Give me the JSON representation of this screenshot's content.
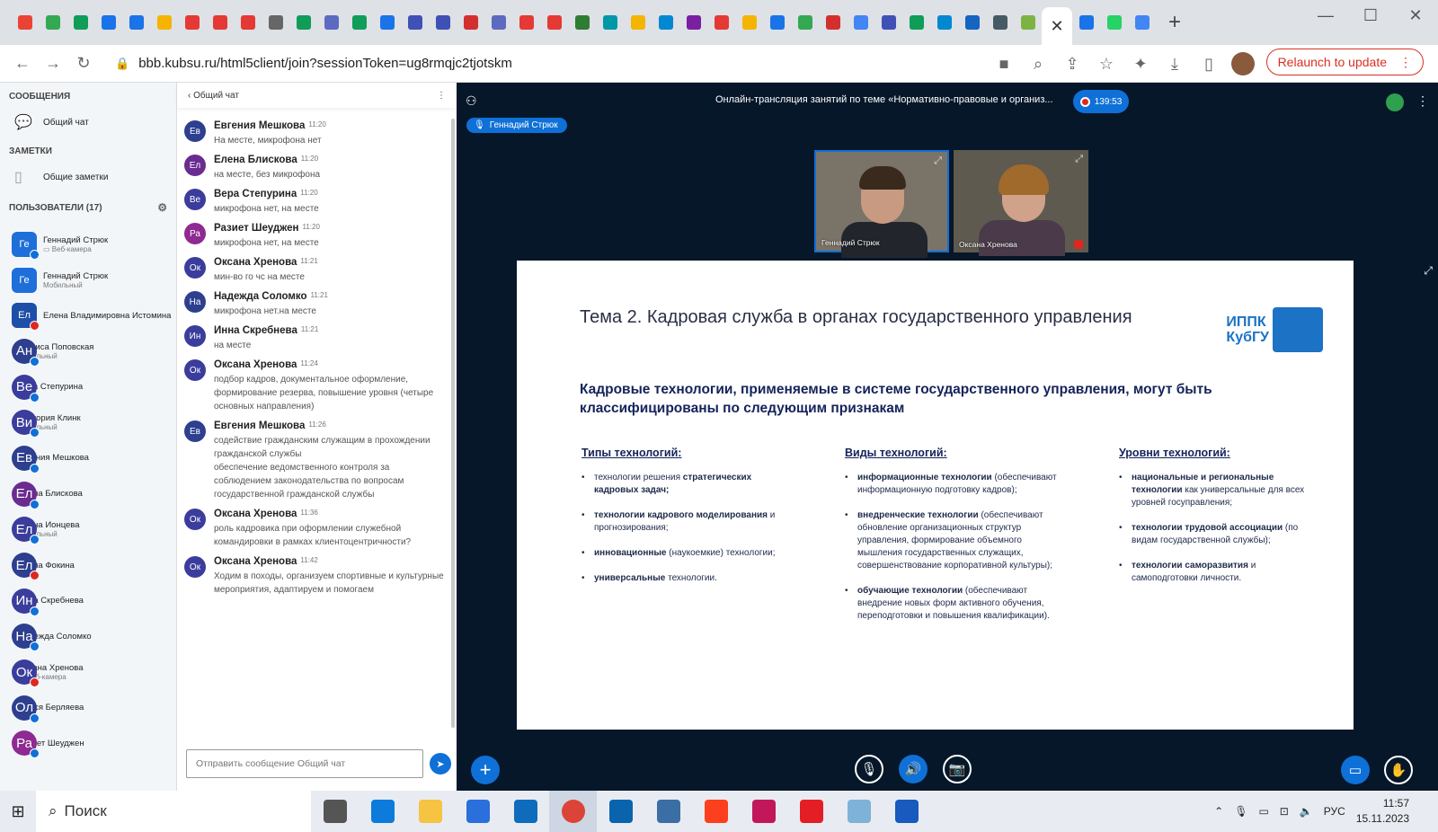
{
  "browser": {
    "tab_colors": [
      "#ea4335",
      "#34a853",
      "#0f9d58",
      "#1a73e8",
      "#1a73e8",
      "#f4b400",
      "#e53935",
      "#e53935",
      "#e53935",
      "#666666",
      "#0f9d58",
      "#5c6bc0",
      "#0f9d58",
      "#1a73e8",
      "#3f51b5",
      "#3f51b5",
      "#d32f2f",
      "#5c6bc0",
      "#e53935",
      "#e53935",
      "#2e7d32",
      "#0097a7",
      "#f4b400",
      "#0288d1",
      "#7b1fa2",
      "#e53935",
      "#f4b400",
      "#1a73e8",
      "#34a853",
      "#d32f2f",
      "#4285f4",
      "#3f51b5",
      "#0f9d58",
      "#0288d1",
      "#1565c0",
      "#455a64",
      "#7cb342",
      "#1a73e8",
      "#25d366",
      "#4285f4"
    ],
    "active_tab_close": "✕",
    "url": "bbb.kubsu.ru/html5client/join?sessionToken=ug8rmqjc2tjotskm",
    "relaunch_label": "Relaunch to update"
  },
  "sidebar": {
    "messages_title": "СООБЩЕНИЯ",
    "public_chat": "Общий чат",
    "notes_title": "ЗАМЕТКИ",
    "shared_notes": "Общие заметки",
    "users_title": "ПОЛЬЗОВАТЕЛИ (17)",
    "users": [
      {
        "initials": "Ге",
        "name": "Геннадий Стрюк",
        "sub": "▭ Веб-камера",
        "color": "#1e6fd9",
        "shape": "square",
        "status": "blue"
      },
      {
        "initials": "Ге",
        "name": "Геннадий Стрюк",
        "sub": "Мобильный",
        "color": "#1e6fd9",
        "shape": "square",
        "status": ""
      },
      {
        "initials": "Ел",
        "name": "Елена Владимировна Истомина",
        "sub": "",
        "color": "#1e4fa8",
        "shape": "square",
        "status": "red"
      },
      {
        "initials": "Ан",
        "name": "Анфиса Поповская",
        "sub": "Мобильный",
        "color": "#2d3f8e",
        "shape": "round",
        "status": "blue"
      },
      {
        "initials": "Ве",
        "name": "Вера Степурина",
        "sub": "",
        "color": "#3b3d9c",
        "shape": "round",
        "status": "blue"
      },
      {
        "initials": "Ви",
        "name": "Виктория Клинк",
        "sub": "Мобильный",
        "color": "#3b3d9c",
        "shape": "round",
        "status": "blue"
      },
      {
        "initials": "Ев",
        "name": "Евгения Мешкова",
        "sub": "",
        "color": "#2d3f8e",
        "shape": "round",
        "status": "blue"
      },
      {
        "initials": "Ел",
        "name": "Елена Блискова",
        "sub": "",
        "color": "#6a2c91",
        "shape": "round",
        "status": "blue"
      },
      {
        "initials": "Ел",
        "name": "Елена Ионцева",
        "sub": "Мобильный",
        "color": "#3b3d9c",
        "shape": "round",
        "status": "blue"
      },
      {
        "initials": "Ел",
        "name": "Елена Фокина",
        "sub": "",
        "color": "#2d3f8e",
        "shape": "round",
        "status": "red"
      },
      {
        "initials": "Ин",
        "name": "Инна Скребнева",
        "sub": "",
        "color": "#3b3d9c",
        "shape": "round",
        "status": "blue"
      },
      {
        "initials": "На",
        "name": "Надежда Соломко",
        "sub": "",
        "color": "#2d3f8e",
        "shape": "round",
        "status": "blue"
      },
      {
        "initials": "Ок",
        "name": "Оксана Хренова",
        "sub": "▭ Веб-камера",
        "color": "#3b3d9c",
        "shape": "round",
        "status": "red"
      },
      {
        "initials": "Ол",
        "name": "Олеся Берляева",
        "sub": "",
        "color": "#2d3f8e",
        "shape": "round",
        "status": "blue"
      },
      {
        "initials": "Ра",
        "name": "Разиет Шеуджен",
        "sub": "",
        "color": "#8e2a91",
        "shape": "round",
        "status": "blue"
      }
    ]
  },
  "chat": {
    "title": "Общий чат",
    "input_placeholder": "Отправить сообщение Общий чат",
    "messages": [
      {
        "initials": "Ев",
        "color": "#2d3f8e",
        "name": "Евгения Мешкова",
        "time": "11:20",
        "text": "На месте, микрофона нет"
      },
      {
        "initials": "Ел",
        "color": "#6a2c91",
        "name": "Елена Блискова",
        "time": "11:20",
        "text": "на месте, без микрофона"
      },
      {
        "initials": "Ве",
        "color": "#3b3d9c",
        "name": "Вера Степурина",
        "time": "11:20",
        "text": "микрофона нет, на месте"
      },
      {
        "initials": "Ра",
        "color": "#8e2a91",
        "name": "Разиет Шеуджен",
        "time": "11:20",
        "text": "микрофона нет, на месте"
      },
      {
        "initials": "Ок",
        "color": "#3b3d9c",
        "name": "Оксана Хренова",
        "time": "11:21",
        "text": "мин-во го чс на месте"
      },
      {
        "initials": "На",
        "color": "#2d3f8e",
        "name": "Надежда Соломко",
        "time": "11:21",
        "text": "микрофона нет.на месте"
      },
      {
        "initials": "Ин",
        "color": "#3b3d9c",
        "name": "Инна Скребнева",
        "time": "11:21",
        "text": "на месте"
      },
      {
        "initials": "Ок",
        "color": "#3b3d9c",
        "name": "Оксана Хренова",
        "time": "11:24",
        "text": "подбор кадров, документальное оформление, формирование резерва, повышение уровня (четыре основных направления)"
      },
      {
        "initials": "Ев",
        "color": "#2d3f8e",
        "name": "Евгения Мешкова",
        "time": "11:26",
        "text": "содействие гражданским служащим в прохождении гражданской службы\nобеспечение ведомственного контроля за соблюдением законодательства по вопросам государственной гражданской службы"
      },
      {
        "initials": "Ок",
        "color": "#3b3d9c",
        "name": "Оксана Хренова",
        "time": "11:36",
        "text": "роль кадровика при оформлении служебной командировки в рамках клиентоцентричности?"
      },
      {
        "initials": "Ок",
        "color": "#3b3d9c",
        "name": "Оксана Хренова",
        "time": "11:42",
        "text": "Ходим в походы, организуем спортивные и культурные мероприятия, адаптируем и помогаем"
      }
    ]
  },
  "meeting": {
    "title": "Онлайн-трансляция занятий по теме «Нормативно-правовые и организ...",
    "rec_time": "139:53",
    "talking": "Геннадий Стрюк",
    "cams": [
      {
        "name": "Геннадий Стрюк"
      },
      {
        "name": "Оксана Хренова"
      }
    ]
  },
  "slide": {
    "title": "Тема 2. Кадровая служба в органах государственного управления",
    "logo_line1": "ИППК",
    "logo_line2": "КубГУ",
    "subtitle": "Кадровые технологии, применяемые в системе государственного управления, могут быть классифицированы по следующим признакам",
    "columns": [
      {
        "heading": "Типы технологий:",
        "items": [
          {
            "b": "",
            "t": "технологии решения ",
            "b2": "стратегических кадровых задач;",
            "t2": ""
          },
          {
            "b": "технологии кадрового моделирования",
            "t": " и прогнозирования;",
            "b2": "",
            "t2": ""
          },
          {
            "b": "инновационные",
            "t": " (наукоемкие) технологии;",
            "b2": "",
            "t2": ""
          },
          {
            "b": "универсальные",
            "t": " технологии.",
            "b2": "",
            "t2": ""
          }
        ]
      },
      {
        "heading": "Виды технологий:",
        "items": [
          {
            "b": "информационные технологии",
            "t": " (обеспечивают информационную подготовку кадров);",
            "b2": "",
            "t2": ""
          },
          {
            "b": "внедренческие технологии",
            "t": " (обеспечивают обновление организационных структур управления, формирование объемного мышления государственных служащих, совершенствование корпоративной культуры);",
            "b2": "",
            "t2": ""
          },
          {
            "b": "обучающие технологии",
            "t": " (обеспечивают внедрение новых форм активного обучения, переподготовки и повышения квалификации).",
            "b2": "",
            "t2": ""
          }
        ]
      },
      {
        "heading": "Уровни технологий:",
        "items": [
          {
            "b": "национальные и региональные технологии",
            "t": " как универсальные для всех уровней госуправления;",
            "b2": "",
            "t2": ""
          },
          {
            "b": "технологии трудовой ассоциации",
            "t": " (по видам государственной службы);",
            "b2": "",
            "t2": ""
          },
          {
            "b": "технологии саморазвития",
            "t": " и самоподготовки личности.",
            "b2": "",
            "t2": ""
          }
        ]
      }
    ]
  },
  "taskbar": {
    "search": "Поиск",
    "lang": "РУС",
    "time": "11:57",
    "date": "15.11.2023",
    "apps": [
      {
        "name": "task-view",
        "color": "#555555"
      },
      {
        "name": "edge",
        "color": "#0c7bdc"
      },
      {
        "name": "explorer",
        "color": "#f6c343"
      },
      {
        "name": "store",
        "color": "#2a6fdb"
      },
      {
        "name": "mail",
        "color": "#0f6cbd"
      },
      {
        "name": "chrome",
        "color": "#db4437"
      },
      {
        "name": "outlook",
        "color": "#0a64ad"
      },
      {
        "name": "calculator",
        "color": "#3a6ea5"
      },
      {
        "name": "yandex",
        "color": "#fc3f1d"
      },
      {
        "name": "app-flower",
        "color": "#c2185b"
      },
      {
        "name": "app-red",
        "color": "#e31e24"
      },
      {
        "name": "notepad",
        "color": "#7fb2d8"
      },
      {
        "name": "word",
        "color": "#185abd"
      }
    ]
  }
}
